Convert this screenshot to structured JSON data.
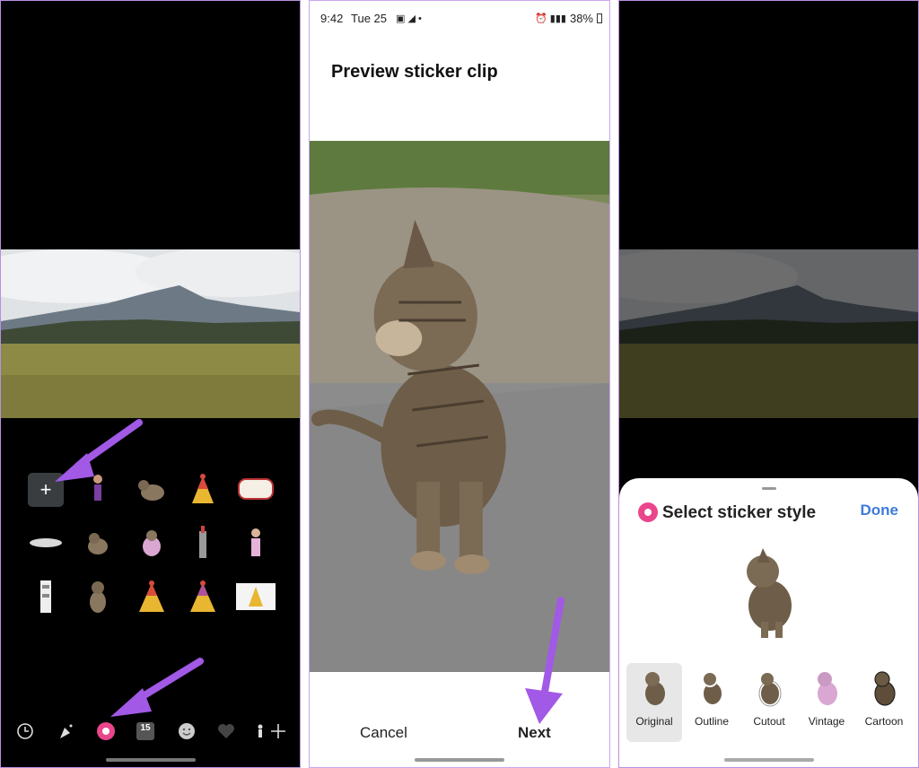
{
  "panel_editor": {
    "add_label": "+",
    "calendar_day": "15"
  },
  "panel_preview": {
    "status": {
      "time": "9:42",
      "day": "Tue 25",
      "battery": "38%"
    },
    "title": "Preview sticker clip",
    "cancel_label": "Cancel",
    "next_label": "Next"
  },
  "panel_style": {
    "title": "Select sticker style",
    "done_label": "Done",
    "styles": [
      {
        "label": "Original",
        "selected": true
      },
      {
        "label": "Outline",
        "selected": false
      },
      {
        "label": "Cutout",
        "selected": false
      },
      {
        "label": "Vintage",
        "selected": false
      },
      {
        "label": "Cartoon",
        "selected": false
      }
    ]
  },
  "colors": {
    "annotation_arrow": "#a259e6",
    "done_accent": "#3d7bdb",
    "sticker_tab_accent": "#e9468c"
  }
}
